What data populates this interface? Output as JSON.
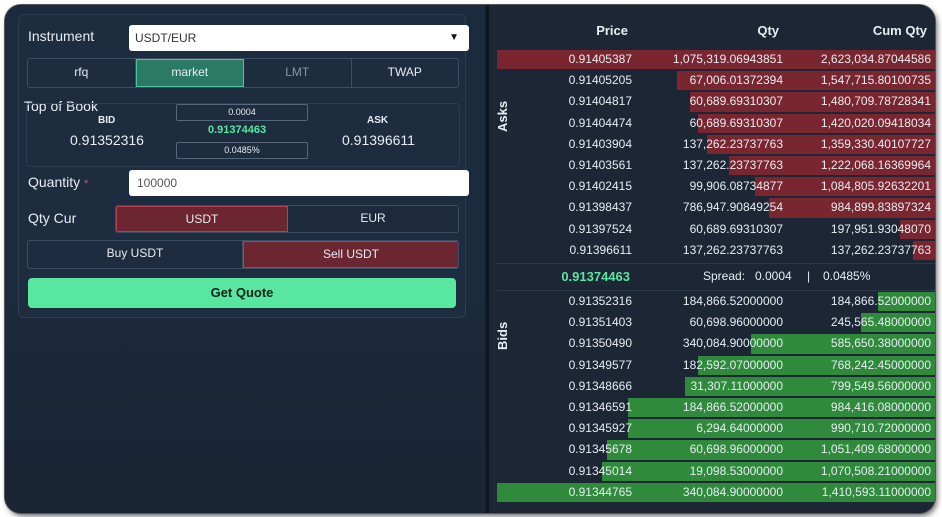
{
  "form": {
    "instrument_label": "Instrument",
    "instrument_value": "USDT/EUR",
    "order_types": [
      "rfq",
      "market",
      "LMT",
      "TWAP"
    ],
    "top_of_book_label": "Top of Book",
    "bid_label": "BID",
    "bid_value": "0.91352316",
    "ask_label": "ASK",
    "ask_value": "0.91396611",
    "spread_abs": "0.0004",
    "mid_value": "0.91374463",
    "spread_pct": "0.0485%",
    "quantity_label": "Quantity",
    "required_mark": "*",
    "quantity_value": "100000",
    "qty_cur_label": "Qty Cur",
    "currencies": [
      "USDT",
      "EUR"
    ],
    "sides": [
      "Buy USDT",
      "Sell USDT"
    ],
    "get_quote": "Get Quote"
  },
  "book": {
    "headers": {
      "price": "Price",
      "qty": "Qty",
      "cum": "Cum Qty"
    },
    "asks_label": "Asks",
    "bids_label": "Bids",
    "mid_price": "0.91374463",
    "spread_label": "Spread:",
    "spread_value": "0.0004",
    "sep": "|",
    "spread_pct": "0.0485%",
    "asks": [
      {
        "price": "0.91405387",
        "qty": "1,075,319.06943851",
        "cum": "2,623,034.87044586",
        "depth": 1.0
      },
      {
        "price": "0.91405205",
        "qty": "67,006.01372394",
        "cum": "1,547,715.80100735",
        "depth": 0.59
      },
      {
        "price": "0.91404817",
        "qty": "60,689.69310307",
        "cum": "1,480,709.78728341",
        "depth": 0.56
      },
      {
        "price": "0.91404474",
        "qty": "60,689.69310307",
        "cum": "1,420,020.09418034",
        "depth": 0.54
      },
      {
        "price": "0.91403904",
        "qty": "137,262.23737763",
        "cum": "1,359,330.40107727",
        "depth": 0.52
      },
      {
        "price": "0.91403561",
        "qty": "137,262.23737763",
        "cum": "1,222,068.16369964",
        "depth": 0.47
      },
      {
        "price": "0.91402415",
        "qty": "99,906.08734877",
        "cum": "1,084,805.92632201",
        "depth": 0.41
      },
      {
        "price": "0.91398437",
        "qty": "786,947.90849254",
        "cum": "984,899.83897324",
        "depth": 0.38
      },
      {
        "price": "0.91397524",
        "qty": "60,689.69310307",
        "cum": "197,951.93048070",
        "depth": 0.08
      },
      {
        "price": "0.91396611",
        "qty": "137,262.23737763",
        "cum": "137,262.23737763",
        "depth": 0.05
      }
    ],
    "bids": [
      {
        "price": "0.91352316",
        "qty": "184,866.52000000",
        "cum": "184,866.52000000",
        "depth": 0.13
      },
      {
        "price": "0.91351403",
        "qty": "60,698.96000000",
        "cum": "245,565.48000000",
        "depth": 0.17
      },
      {
        "price": "0.91350490",
        "qty": "340,084.90000000",
        "cum": "585,650.38000000",
        "depth": 0.42
      },
      {
        "price": "0.91349577",
        "qty": "182,592.07000000",
        "cum": "768,242.45000000",
        "depth": 0.54
      },
      {
        "price": "0.91348666",
        "qty": "31,307.11000000",
        "cum": "799,549.56000000",
        "depth": 0.57
      },
      {
        "price": "0.91346591",
        "qty": "184,866.52000000",
        "cum": "984,416.08000000",
        "depth": 0.7
      },
      {
        "price": "0.91345927",
        "qty": "6,294.64000000",
        "cum": "990,710.72000000",
        "depth": 0.7
      },
      {
        "price": "0.91345678",
        "qty": "60,698.96000000",
        "cum": "1,051,409.68000000",
        "depth": 0.75
      },
      {
        "price": "0.91345014",
        "qty": "19,098.53000000",
        "cum": "1,070,508.21000000",
        "depth": 0.76
      },
      {
        "price": "0.91344765",
        "qty": "340,084.90000000",
        "cum": "1,410,593.11000000",
        "depth": 1.0
      }
    ]
  },
  "colors": {
    "ask": "#7a2630",
    "bid": "#2f8a3c",
    "accent": "#58e6a0"
  }
}
